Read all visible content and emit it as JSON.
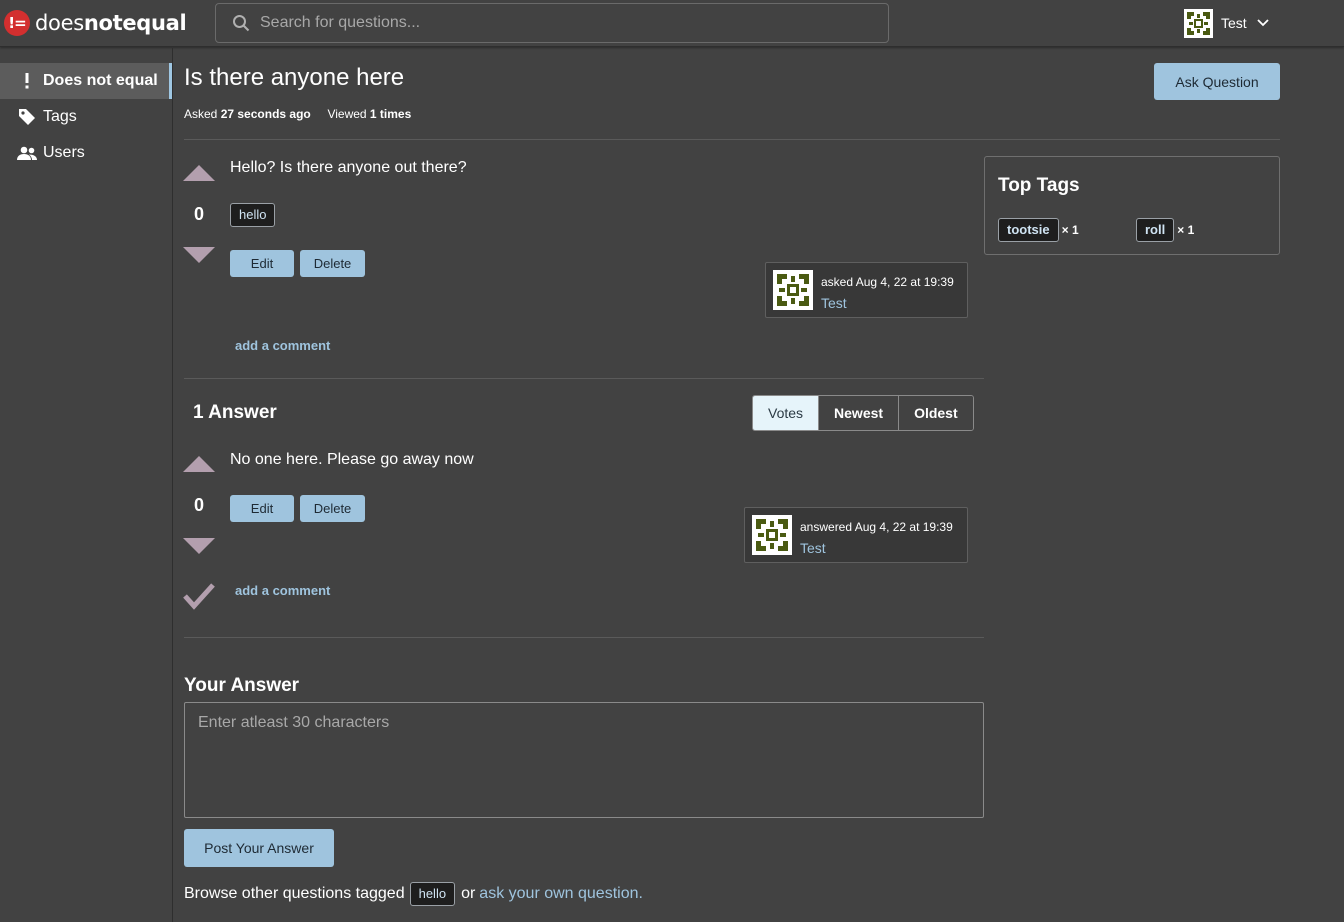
{
  "app": {
    "logo_badge": "!=",
    "logo_text_light": "does",
    "logo_text_bold": "notequal"
  },
  "search": {
    "placeholder": "Search for questions..."
  },
  "user": {
    "name": "Test"
  },
  "sidebar": {
    "items": [
      {
        "label": "Does not equal",
        "icon": "exclamation-icon",
        "active": true
      },
      {
        "label": "Tags",
        "icon": "tag-icon",
        "active": false
      },
      {
        "label": "Users",
        "icon": "users-icon",
        "active": false
      }
    ]
  },
  "question": {
    "title": "Is there anyone here",
    "asked_label": "Asked",
    "asked_value": "27 seconds ago",
    "viewed_label": "Viewed",
    "viewed_value": "1 times",
    "body": "Hello? Is there anyone out there?",
    "votes": "0",
    "tags": [
      "hello"
    ],
    "edit_label": "Edit",
    "delete_label": "Delete",
    "author_when": "asked Aug 4, 22 at 19:39",
    "author_name": "Test",
    "add_comment": "add a comment"
  },
  "ask_button": "Ask Question",
  "answers": {
    "title": "1 Answer",
    "sort": [
      "Votes",
      "Newest",
      "Oldest"
    ],
    "sort_active": "Votes",
    "items": [
      {
        "body": "No one here. Please go away now",
        "votes": "0",
        "edit_label": "Edit",
        "delete_label": "Delete",
        "author_when": "answered Aug 4, 22 at 19:39",
        "author_name": "Test",
        "add_comment": "add a comment"
      }
    ]
  },
  "your_answer": {
    "title": "Your Answer",
    "placeholder": "Enter atleast 30 characters",
    "post_label": "Post Your Answer"
  },
  "browse": {
    "prefix": "Browse other questions tagged",
    "tag": "hello",
    "middle": "or",
    "link": "ask your own question."
  },
  "top_tags": {
    "title": "Top Tags",
    "items": [
      {
        "name": "tootsie",
        "count": "× 1"
      },
      {
        "name": "roll",
        "count": "× 1"
      }
    ]
  },
  "colors": {
    "background": "#424242",
    "accent": "#9fc4de",
    "vote_arrow": "#b39fae",
    "logo_red": "#d32f2f"
  }
}
